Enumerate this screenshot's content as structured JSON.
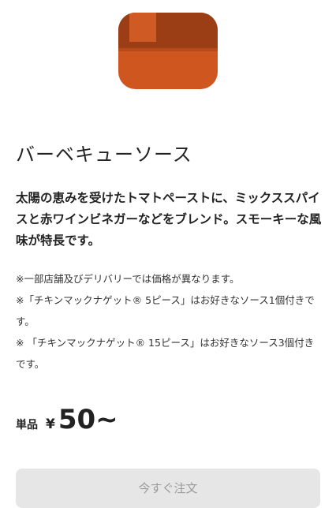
{
  "product": {
    "image_icon": "sauce-container-icon",
    "image_colors": {
      "lid": "#9b3e16",
      "tab": "#d05a24",
      "body": "#d05620"
    },
    "title": "バーベキューソース",
    "description": "太陽の恵みを受けたトマトペーストに、ミックススパイスと赤ワインビネガーなどをブレンド。スモーキーな風味が特長です。",
    "notes": [
      "※一部店舗及びデリバリーでは価格が異なります。",
      "※「チキンマックナゲット® 5ピース」はお好きなソース1個付きです。",
      "※ 「チキンマックナゲット® 15ピース」はお好きなソース3個付きです。"
    ]
  },
  "price": {
    "label": "単品",
    "currency": "¥",
    "value": "50~"
  },
  "order_button": {
    "label": "今すぐ注文",
    "state": "disabled"
  }
}
